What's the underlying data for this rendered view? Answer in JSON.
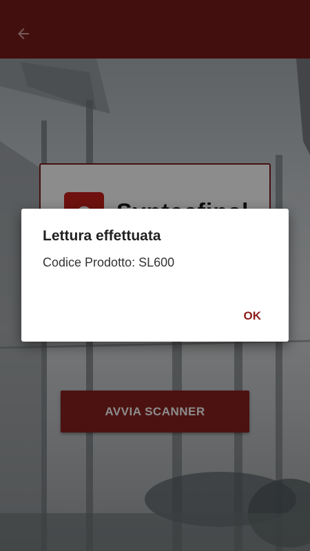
{
  "appbar": {
    "icon": "arrow-back-icon",
    "color": "#7a1c1a"
  },
  "logo": {
    "mark_letter": "e",
    "wordmark": "Syntecfinal"
  },
  "main": {
    "scan_button_label": "AVVIA SCANNER"
  },
  "dialog": {
    "title": "Lettura effettuata",
    "message": "Codice Prodotto: SL600",
    "ok_label": "OK"
  },
  "colors": {
    "brand": "#7a1c1a",
    "dialog_accent": "#8a1c1a",
    "scrim": "rgba(0,0,0,0.45)"
  }
}
